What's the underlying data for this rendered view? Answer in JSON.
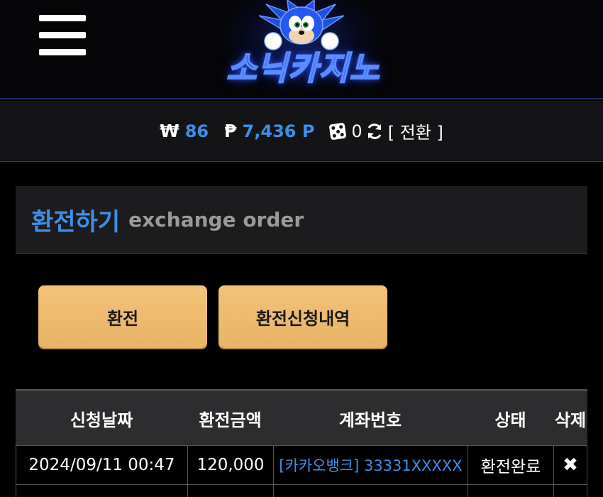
{
  "header": {
    "logo_text": "소닉카지노",
    "menu_icon": "hamburger-menu-icon"
  },
  "balance": {
    "won_symbol": "₩",
    "won_value": "86",
    "point_symbol": "₱",
    "point_value": "7,436 P",
    "dice_count": "0",
    "switch_label": "[ 전환 ]"
  },
  "exchange": {
    "title_ko": "환전하기",
    "title_en": "exchange order",
    "buttons": {
      "exchange_label": "환전",
      "history_label": "환전신청내역"
    }
  },
  "table": {
    "headers": [
      "신청날짜",
      "환전금액",
      "계좌번호",
      "상태",
      "삭제"
    ],
    "rows": [
      {
        "date": "2024/09/11 00:47",
        "amount": "120,000",
        "account": "[카카오뱅크] 33331XXXXX",
        "status": "환전완료",
        "delete": "✖"
      }
    ]
  },
  "colors": {
    "accent_blue": "#3d8fe8",
    "button_gold": "#f0bd72",
    "panel_bg": "#1c1c1e"
  }
}
